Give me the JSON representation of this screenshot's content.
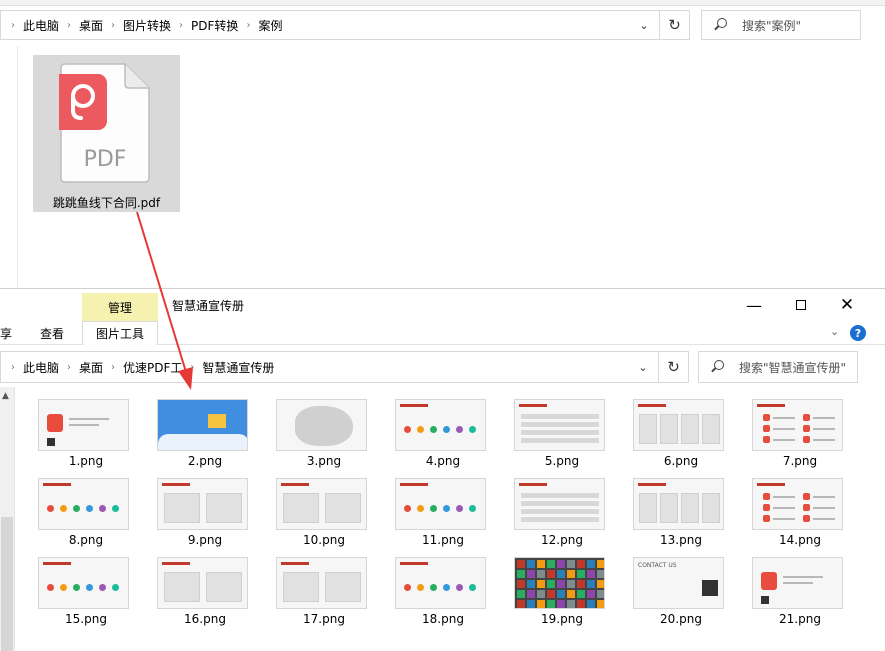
{
  "back_window": {
    "breadcrumb": [
      "此电脑",
      "桌面",
      "图片转换",
      "PDF转换",
      "案例"
    ],
    "search_placeholder": "搜索\"案例\"",
    "file": {
      "name": "跳跳鱼线下合同.pdf",
      "icon_text": "PDF"
    }
  },
  "front_window": {
    "title": "智慧通宣传册",
    "ribbon": {
      "context_header": "管理",
      "tabs": [
        "享",
        "查看",
        "图片工具"
      ]
    },
    "breadcrumb": [
      "此电脑",
      "桌面",
      "优速PDF工",
      "智慧通宣传册"
    ],
    "search_placeholder": "搜索\"智慧通宣传册\"",
    "files": [
      "1.png",
      "2.png",
      "3.png",
      "4.png",
      "5.png",
      "6.png",
      "7.png",
      "8.png",
      "9.png",
      "10.png",
      "11.png",
      "12.png",
      "13.png",
      "14.png",
      "15.png",
      "16.png",
      "17.png",
      "18.png",
      "19.png",
      "20.png",
      "21.png"
    ],
    "thumb_texts": {
      "contact": "CONTACT US"
    }
  },
  "colors": {
    "pdf_brand": "#ec5a5f",
    "arrow": "#e53935",
    "manage_tab": "#f5f2b0",
    "help": "#1c6dd0"
  }
}
